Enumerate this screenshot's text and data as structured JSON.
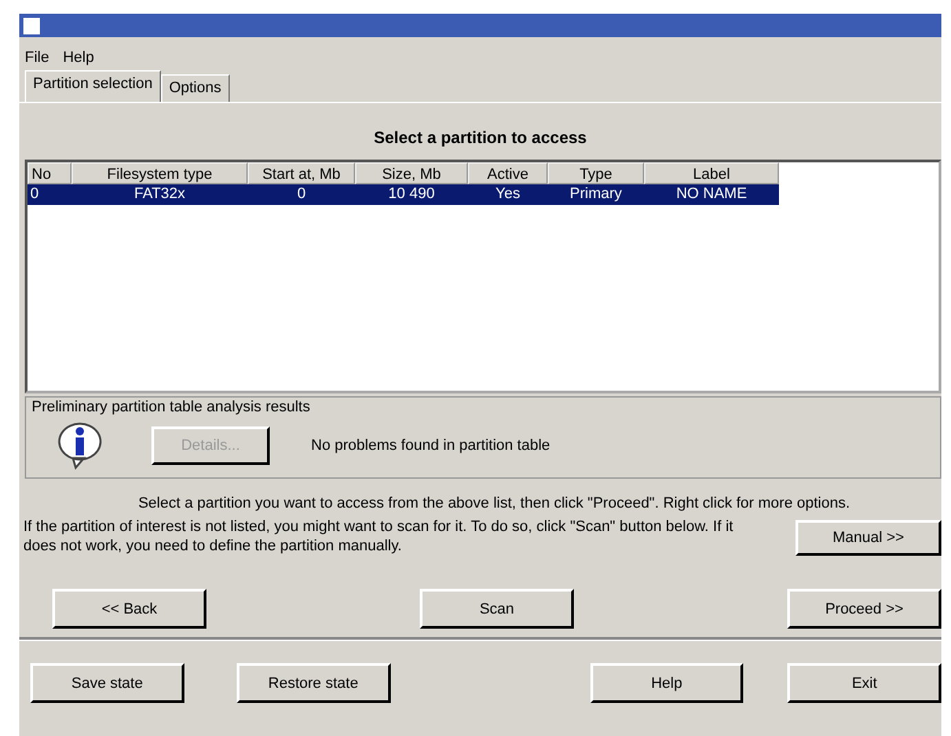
{
  "menu": [
    "File",
    "Help"
  ],
  "tabs": [
    {
      "label": "Partition selection",
      "selected": true
    },
    {
      "label": "Options",
      "selected": false
    }
  ],
  "heading": "Select a partition to access",
  "table": {
    "columns": [
      "No",
      "Filesystem type",
      "Start at, Mb",
      "Size, Mb",
      "Active",
      "Type",
      "Label"
    ],
    "rows": [
      {
        "selected": true,
        "cells": [
          "0",
          "FAT32x",
          "0",
          "10 490",
          "Yes",
          "Primary",
          "NO NAME"
        ]
      }
    ]
  },
  "analysis": {
    "title": "Preliminary partition table analysis results",
    "button": {
      "label": "Details...",
      "disabled": true
    },
    "message": "No problems found in partition table"
  },
  "instruction": "Select a partition you want to access from the above list, then click \"Proceed\". Right click for more options.",
  "hint": "If the partition of interest is not listed, you might want to scan for it. To do so, click \"Scan\" button below. If it does not work, you need to define the partition manually.",
  "manual_button": "Manual >>",
  "nav_buttons": [
    "<< Back",
    "Scan",
    "Proceed >>"
  ],
  "bottom_buttons": [
    "Save state",
    "Restore state",
    "Help",
    "Exit"
  ]
}
